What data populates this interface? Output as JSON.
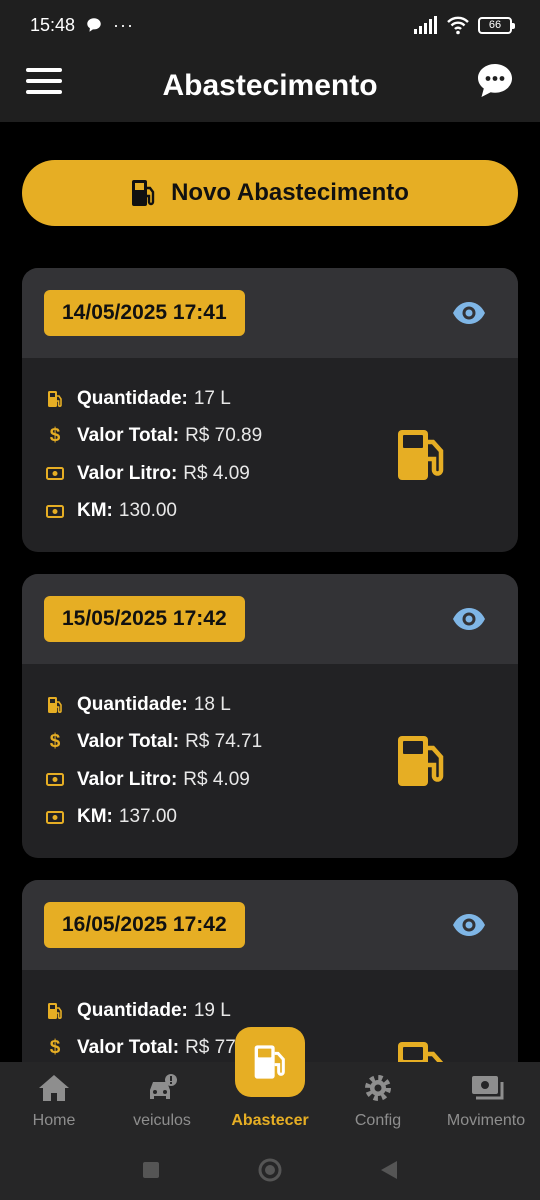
{
  "status": {
    "time": "15:48",
    "dots": "···",
    "battery": "66"
  },
  "header": {
    "title": "Abastecimento"
  },
  "new_button": {
    "label": "Novo Abastecimento"
  },
  "labels": {
    "quantity": "Quantidade:",
    "total": "Valor Total:",
    "price": "Valor Litro:",
    "km": "KM:"
  },
  "records": [
    {
      "date": "14/05/2025 17:41",
      "quantity": "17 L",
      "total": "R$ 70.89",
      "price": "R$ 4.09",
      "km": "130.00"
    },
    {
      "date": "15/05/2025 17:42",
      "quantity": "18 L",
      "total": "R$ 74.71",
      "price": "R$ 4.09",
      "km": "137.00"
    },
    {
      "date": "16/05/2025 17:42",
      "quantity": "19 L",
      "total": "R$ 77.",
      "price": "",
      "km": ""
    }
  ],
  "nav": [
    {
      "label": "Home",
      "icon": "home-icon"
    },
    {
      "label": "veiculos",
      "icon": "car-icon"
    },
    {
      "label": "Abastecer",
      "icon": "gas-pump-icon",
      "active": true
    },
    {
      "label": "Config",
      "icon": "gear-icon"
    },
    {
      "label": "Movimento",
      "icon": "money-icon"
    }
  ],
  "colors": {
    "accent": "#e6ae24",
    "background": "#000000",
    "card": "#222224",
    "card_header": "#333336",
    "eye": "#7fb6e6"
  }
}
